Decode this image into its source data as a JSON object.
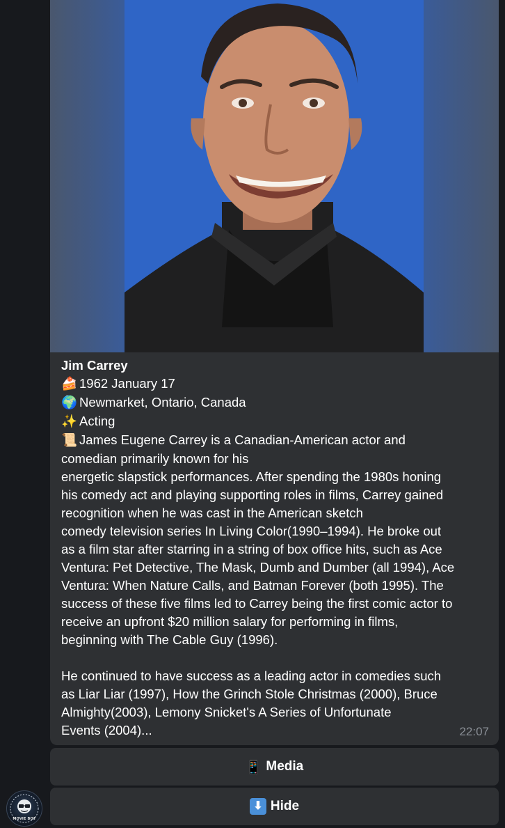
{
  "bot_avatar": {
    "badge_text": "MOVIE BOT"
  },
  "message": {
    "name": "Jim Carrey",
    "birth_icon": "🍰",
    "birth": "1962 January 17",
    "place_icon": "🌍",
    "place": "Newmarket, Ontario, Canada",
    "dept_icon": "✨",
    "department": "Acting",
    "bio_icon": "📜",
    "bio_lines": [
      "James Eugene Carrey is a Canadian-American actor and",
      "comedian primarily known for his",
      "energetic slapstick performances. After spending the 1980s honing",
      "his comedy act and playing supporting roles in films, Carrey gained",
      "recognition when he was cast in the American sketch",
      "comedy television series In Living Color(1990–1994). He broke out",
      "as a film star after starring in a string of box office hits, such as Ace",
      "Ventura: Pet Detective, The Mask, Dumb and Dumber (all 1994), Ace",
      "Ventura: When Nature Calls, and Batman Forever (both 1995). The",
      "success of these five films led to Carrey being the first comic actor to",
      "receive an upfront $20 million salary for performing in films,",
      "beginning with The Cable Guy (1996).",
      "",
      "He continued to have success as a leading actor in comedies such",
      "as Liar Liar (1997), How the Grinch Stole Christmas (2000), Bruce",
      "Almighty(2003), Lemony Snicket's A Series of Unfortunate",
      "Events (2004)..."
    ],
    "time": "22:07"
  },
  "buttons": {
    "media_icon": "📱",
    "media_label": "Media",
    "hide_icon": "⬇",
    "hide_label": "Hide"
  }
}
